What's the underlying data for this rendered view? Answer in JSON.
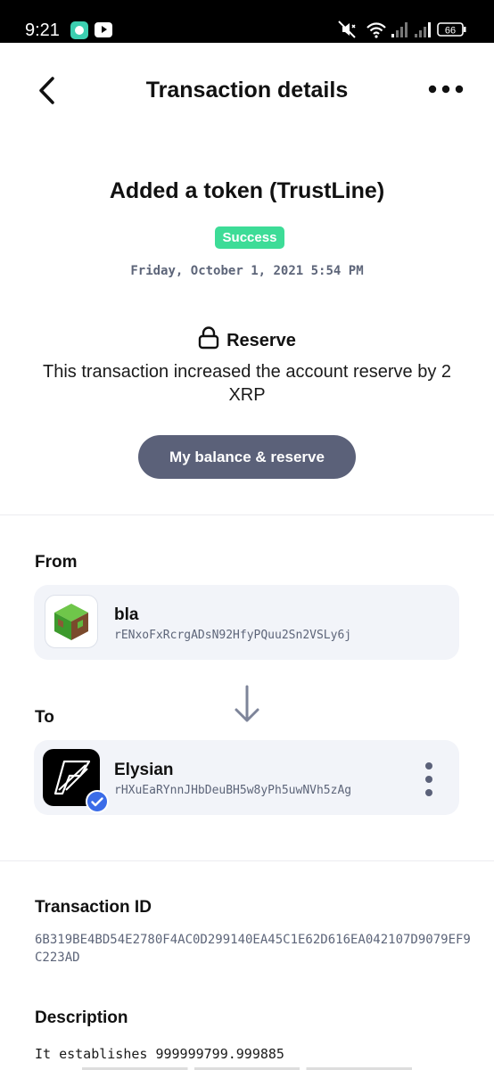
{
  "status_bar": {
    "time": "9:21",
    "battery": "66",
    "icons": [
      "chat-app-icon",
      "youtube-icon",
      "mute-icon",
      "wifi-icon",
      "signal-icon",
      "signal-icon",
      "battery-icon"
    ]
  },
  "nav": {
    "title": "Transaction details",
    "back_icon": "chevron-left-icon",
    "more_icon": "more-horizontal-icon"
  },
  "transaction": {
    "title": "Added a token (TrustLine)",
    "status": "Success",
    "datetime": "Friday, October 1, 2021 5:54 PM"
  },
  "reserve": {
    "title": "Reserve",
    "icon": "lock-icon",
    "text": "This transaction increased the account reserve by 2 XRP",
    "button_label": "My balance & reserve"
  },
  "from": {
    "label": "From",
    "name": "bla",
    "address": "rENxoFxRcrgADsN92HfyPQuu2Sn2VSLy6j"
  },
  "to": {
    "label": "To",
    "name": "Elysian",
    "address": "rHXuEaRYnnJHbDeuBH5w8yPh5uwNVh5zAg"
  },
  "transaction_id": {
    "label": "Transaction ID",
    "value": "6B319BE4BD54E2780F4AC0D299140EA45C1E62D616EA042107D9079EF9C223AD"
  },
  "description": {
    "label": "Description",
    "text": "It establishes 999999799.999885"
  },
  "colors": {
    "success": "#3ddc97",
    "button": "#5b6179",
    "card": "#f2f4f9",
    "muted_text": "#5d6579",
    "verified": "#3b6ce8"
  }
}
